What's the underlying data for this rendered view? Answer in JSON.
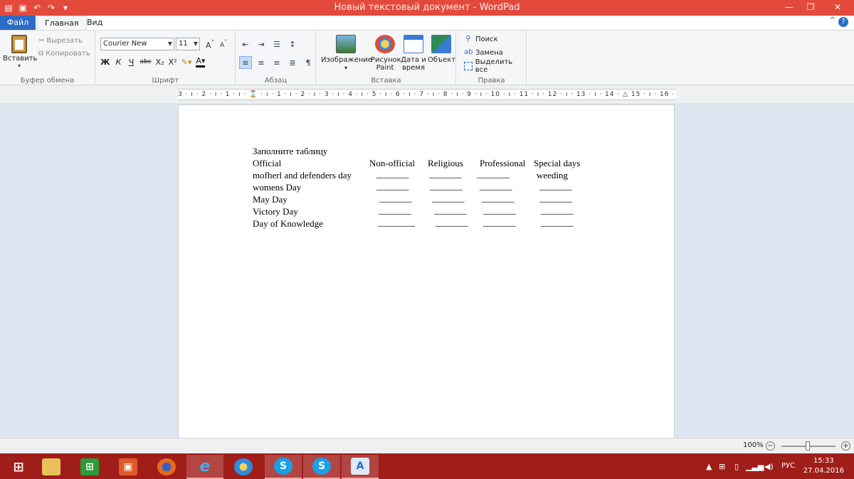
{
  "window": {
    "title": "Новый текстовый документ - WordPad",
    "minimize": "—",
    "maximize": "❐",
    "close": "✕"
  },
  "tabs": [
    {
      "label": "Файл"
    },
    {
      "label": "Главная"
    },
    {
      "label": "Вид"
    }
  ],
  "ribbon": {
    "clipboard": {
      "paste": "Вставить",
      "cut": "Вырезать",
      "copy": "Копировать",
      "group": "Буфер обмена"
    },
    "font": {
      "family": "Courier New",
      "size": "11",
      "group": "Шрифт",
      "bold": "Ж",
      "italic": "К",
      "underline": "Ч",
      "strike": "abc",
      "subscript": "X₂",
      "superscript": "X²"
    },
    "paragraph": {
      "group": "Абзац"
    },
    "insert": {
      "image": "Изображение",
      "paint_line1": "Рисунок",
      "paint_line2": "Paint",
      "datetime_line1": "Дата и",
      "datetime_line2": "время",
      "object": "Объект",
      "group": "Вставка"
    },
    "edit": {
      "find": "Поиск",
      "replace": "Замена",
      "select_all": "Выделить все",
      "group": "Правка"
    }
  },
  "ruler": {
    "text": "3 · ı · 2 · ı · 1 · ı · ⌛ · ı · 1 · ı · 2 · ı · 3 · ı · 4 · ı · 5 · ı · 6 · ı · 7 · ı · 8 · ı · 9 · ı · 10 · ı · 11 · ı · 12 · ı · 13 · ı · 14 · △ 15 · ı · 16 · ı · 17 · ı"
  },
  "document": {
    "heading": "Заполните таблицу",
    "header_row": {
      "official": "Official",
      "non_official": "Non-official",
      "religious": "Religious",
      "professional": "Professional",
      "special": "Special days"
    },
    "rows": [
      {
        "label": "mofherl  and defenders  day",
        "c1": "_______",
        "c2": "_______",
        "c3": "_______",
        "c4": "weeding"
      },
      {
        "label": "womens  Day",
        "c1": "_______",
        "c2": "_______",
        "c3": "_______",
        "c4": "_______"
      },
      {
        "label": "May Day",
        "c1": "_______",
        "c2": "_______",
        "c3": "_______",
        "c4": "_______"
      },
      {
        "label": "Victory  Day",
        "c1": "_______",
        "c2": "_______",
        "c3": "_______",
        "c4": "_______"
      },
      {
        "label": "Day of Knowledge",
        "c1": "________",
        "c2": "_______",
        "c3": "_______",
        "c4": "_______"
      }
    ]
  },
  "status": {
    "zoom": "100%"
  },
  "taskbar": {
    "language": "РУС",
    "time": "15:33",
    "date": "27.04.2016"
  }
}
